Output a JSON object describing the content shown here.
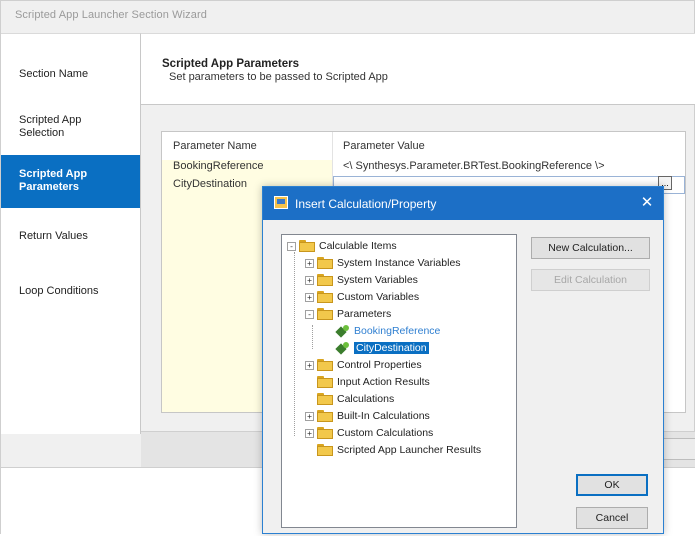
{
  "wizard": {
    "title": "Scripted App Launcher Section Wizard",
    "nav": [
      {
        "label": "Section Name"
      },
      {
        "label": "Scripted App Selection"
      },
      {
        "label": "Scripted App Parameters",
        "selected": true
      },
      {
        "label": "Return Values"
      },
      {
        "label": "Loop Conditions"
      }
    ],
    "header": {
      "title": "Scripted App Parameters",
      "subtitle": "Set parameters to be passed to Scripted App"
    },
    "grid": {
      "columns": [
        "Parameter Name",
        "Parameter Value"
      ],
      "rows": [
        {
          "name": "BookingReference",
          "value": "<\\ Synthesys.Parameter.BRTest.BookingReference \\>"
        },
        {
          "name": "CityDestination",
          "value": ""
        }
      ],
      "ellipsis": "..."
    }
  },
  "dialog": {
    "title": "Insert Calculation/Property",
    "close_glyph": "✕",
    "tree": {
      "root": "Calculable Items",
      "items": [
        {
          "label": "System Instance Variables",
          "expander": "+"
        },
        {
          "label": "System Variables",
          "expander": "+"
        },
        {
          "label": "Custom Variables",
          "expander": "+"
        },
        {
          "label": "Parameters",
          "expander": "-"
        },
        {
          "label": "BookingReference",
          "child": true
        },
        {
          "label": "CityDestination",
          "child": true,
          "selected": true
        },
        {
          "label": "Control Properties",
          "expander": "+"
        },
        {
          "label": "Input Action Results",
          "expander": ""
        },
        {
          "label": "Calculations",
          "expander": ""
        },
        {
          "label": "Built-In Calculations",
          "expander": "+"
        },
        {
          "label": "Custom Calculations",
          "expander": "+"
        },
        {
          "label": "Scripted App Launcher Results",
          "expander": ""
        }
      ]
    },
    "buttons": {
      "new_calculation": "New Calculation...",
      "edit_calculation": "Edit Calculation",
      "ok": "OK",
      "cancel": "Cancel"
    }
  },
  "colors": {
    "accent": "#0a6fc2",
    "dialog_titlebar": "#1c6fc6",
    "grid_name_column": "#fffde2",
    "link": "#2f7fd1"
  },
  "icons": [
    "folder-icon",
    "property-icon",
    "dialog-app-icon",
    "close-icon",
    "ellipsis-icon"
  ]
}
